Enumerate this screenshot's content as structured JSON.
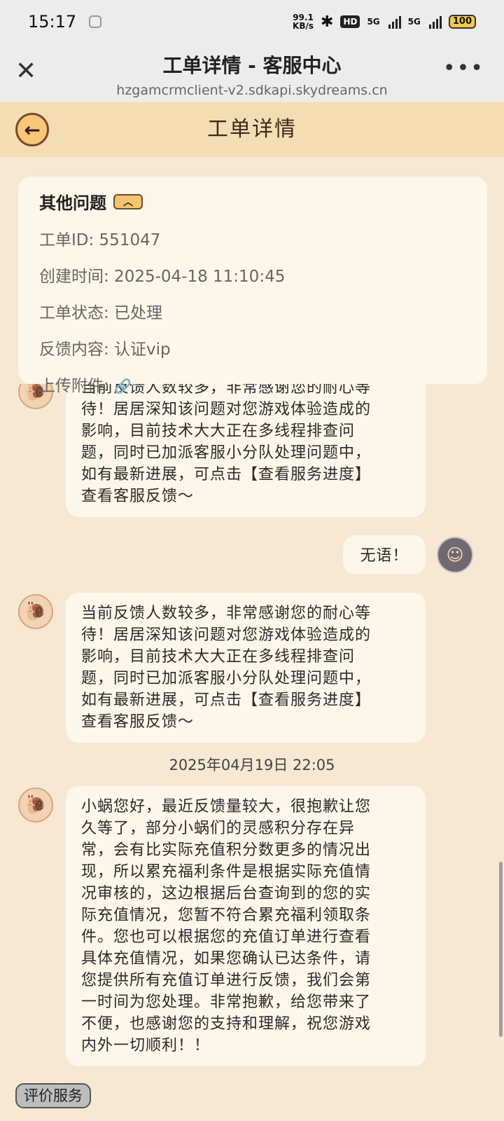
{
  "status_bar": {
    "time": "15:17",
    "net_speed_value": "99.1",
    "net_speed_unit": "KB/s",
    "hd_badge": "HD",
    "sim1": "5G",
    "sim2": "5G",
    "battery": "100"
  },
  "browser": {
    "title": "工单详情 - 客服中心",
    "url": "hzgamcrmclient-v2.sdkapi.skydreams.cn"
  },
  "page": {
    "title": "工单详情"
  },
  "ticket": {
    "category": "其他问题",
    "id_label": "工单ID: 551047",
    "created_label": "创建时间: 2025-04-18 11:10:45",
    "status_label": "工单状态: 已处理",
    "feedback_label": "反馈内容: 认证vip",
    "attachment_label": "上传附件:"
  },
  "messages": [
    {
      "sender": "service",
      "lines": [
        "当前反馈人数较多，非常感谢您的耐心等",
        "待！居居深知该问题对您游戏体验造成的",
        "影响，目前技术大大正在多线程排查问",
        "题，同时已加派客服小分队处理问题中，",
        "如有最新进展，可点击【查看服务进度】",
        "查看客服反馈～"
      ]
    },
    {
      "sender": "user",
      "lines": [
        "无语！"
      ]
    },
    {
      "sender": "service",
      "lines": [
        "当前反馈人数较多，非常感谢您的耐心等",
        "待！居居深知该问题对您游戏体验造成的",
        "影响，目前技术大大正在多线程排查问",
        "题，同时已加派客服小分队处理问题中，",
        "如有最新进展，可点击【查看服务进度】",
        "查看客服反馈～"
      ]
    },
    {
      "sender": "service",
      "lines": [
        "小蜗您好，最近反馈量较大，很抱歉让您",
        "久等了，部分小蜗们的灵感积分存在异",
        "常，会有比实际充值积分数更多的情况出",
        "现，所以累充福利条件是根据实际充值情",
        "况审核的，这边根据后台查询到的您的实",
        "际充值情况，您暂不符合累充福利领取条",
        "件。您也可以根据您的充值订单进行查看",
        "具体充值情况，如果您确认已达条件，请",
        "您提供所有充值订单进行反馈，我们会第",
        "一时间为您处理。非常抱歉，给您带来了",
        "不便，也感谢您的支持和理解，祝您游戏",
        "内外一切顺利！！"
      ]
    }
  ],
  "timestamp": "2025年04月19日 22:05",
  "rate_button": "评价服务"
}
